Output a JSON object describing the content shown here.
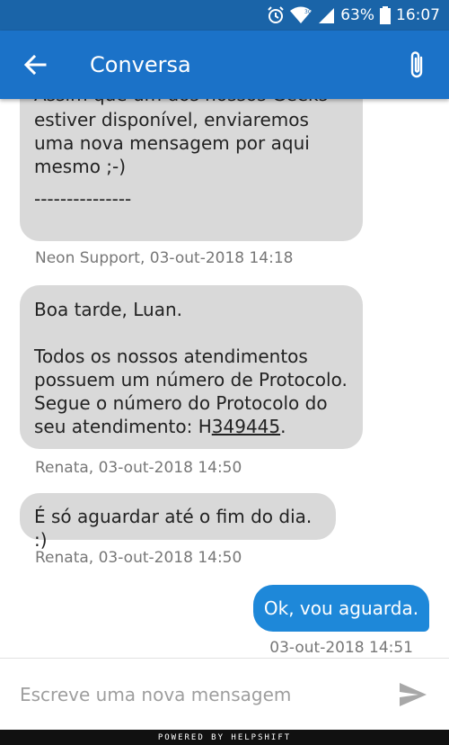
{
  "status_bar": {
    "battery": "63%",
    "time": "16:07",
    "network": "3G"
  },
  "app_bar": {
    "title": "Conversa"
  },
  "messages": [
    {
      "id": "m1",
      "lines_top": "Assim que um dos nossos Geeks",
      "lines_body": "estiver disponível, enviaremos\numa nova mensagem por aqui\nmesmo ;-)",
      "dashes": "---------------",
      "meta": "Neon Support, 03-out-2018 14:18"
    },
    {
      "id": "m2",
      "greeting": "Boa tarde, Luan.",
      "body": "Todos os nossos atendimentos\npossuem um número de Protocolo.\nSegue o número do Protocolo do\nseu atendimento: H",
      "protocol": "349445",
      "end": ".",
      "meta": "Renata, 03-out-2018 14:50"
    },
    {
      "id": "m3",
      "body": "É só aguardar até o fim do dia. :)",
      "meta": "Renata, 03-out-2018 14:50"
    },
    {
      "id": "m4",
      "body": "Ok, vou aguarda.",
      "meta": "03-out-2018 14:51"
    }
  ],
  "composer": {
    "placeholder": "Escreve uma nova mensagem"
  },
  "footer": {
    "text": "POWERED BY HELPSHIFT"
  },
  "colors": {
    "status_bar": "#1a64a8",
    "app_bar": "#1b72c8",
    "my_bubble": "#1e88d9",
    "their_bubble": "#d9d9d9"
  },
  "icons": {
    "back": "arrow-left-icon",
    "attach": "paperclip-icon",
    "send": "send-icon",
    "alarm": "alarm-icon",
    "wifi": "wifi-icon",
    "signal": "signal-icon",
    "battery": "battery-icon"
  }
}
